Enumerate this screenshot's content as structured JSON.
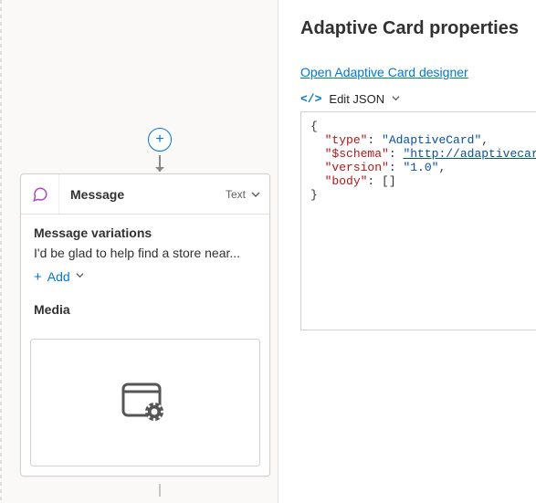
{
  "canvas": {
    "plus_symbol": "+",
    "card": {
      "title": "Message",
      "type_label": "Text",
      "variations_heading": "Message variations",
      "variation_text": "I'd be glad to help find a store near...",
      "add_label": "Add",
      "media_heading": "Media"
    }
  },
  "panel": {
    "title": "Adaptive Card properties",
    "designer_link": "Open Adaptive Card designer",
    "edit_json_label": "Edit JSON",
    "json": {
      "keys": {
        "type": "\"type\"",
        "schema": "\"$schema\"",
        "version": "\"version\"",
        "body": "\"body\""
      },
      "vals": {
        "type": "\"AdaptiveCard\"",
        "schema": "\"http://adaptivecards.i",
        "version": "\"1.0\"",
        "body": "[]"
      }
    }
  }
}
